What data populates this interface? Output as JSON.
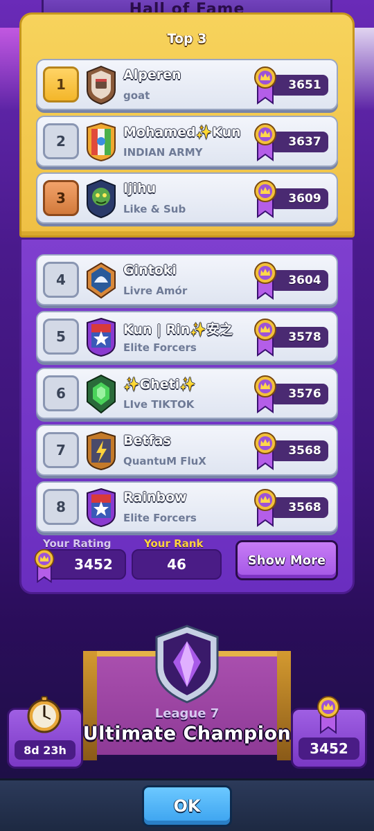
{
  "header": {
    "title": "Hall of Fame"
  },
  "top3": {
    "title": "Top 3",
    "players": [
      {
        "rank": "1",
        "name": "Alperen",
        "clan": "goat",
        "trophies": "3651",
        "rank_style": "gold"
      },
      {
        "rank": "2",
        "name": "Mohamed✨Kun",
        "clan": "INDIAN ARMY",
        "trophies": "3637",
        "rank_style": "silver"
      },
      {
        "rank": "3",
        "name": "Ijihu",
        "clan": "Like & Sub",
        "trophies": "3609",
        "rank_style": "bronze"
      }
    ]
  },
  "list": {
    "players": [
      {
        "rank": "4",
        "name": "Gintoki",
        "clan": "Livre Amór",
        "trophies": "3604"
      },
      {
        "rank": "5",
        "name": "Kun | Rin✨安之",
        "clan": "Elite Forcers",
        "trophies": "3578"
      },
      {
        "rank": "6",
        "name": "✨Gheti✨",
        "clan": "LIve TIKTOK",
        "trophies": "3576"
      },
      {
        "rank": "7",
        "name": "Betfas",
        "clan": "QuantuM FluX",
        "trophies": "3568"
      },
      {
        "rank": "8",
        "name": "Rainbow",
        "clan": "Elite Forcers",
        "trophies": "3568"
      }
    ]
  },
  "stats": {
    "your_rating_label": "Your Rating",
    "your_rating": "3452",
    "your_rank_label": "Your Rank",
    "your_rank": "46",
    "show_more_label": "Show More"
  },
  "league": {
    "subtitle": "League 7",
    "name": "Ultimate Champion",
    "time_left": "8d 23h",
    "rating": "3452"
  },
  "footer": {
    "ok_label": "OK"
  },
  "colors": {
    "gold_panel": "#f3c84a",
    "purple_panel": "#7236c6",
    "rank_label_gold": "#ffd23f",
    "ok_button": "#4ab2f7"
  }
}
